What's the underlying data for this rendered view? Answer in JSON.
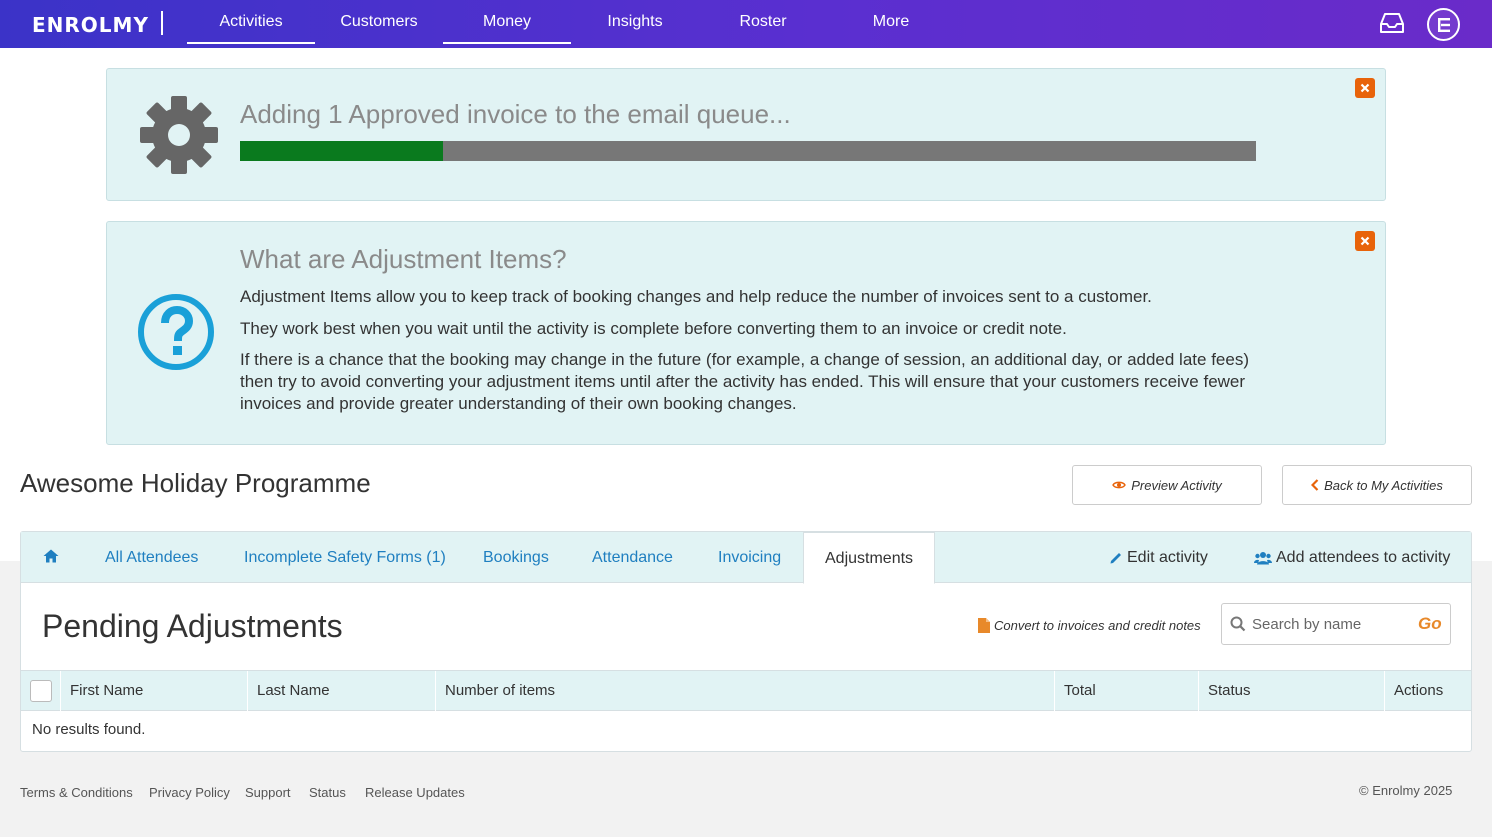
{
  "nav": {
    "logo": "ENROLMY",
    "items": [
      {
        "label": "Activities",
        "active": true
      },
      {
        "label": "Customers",
        "active": false
      },
      {
        "label": "Money",
        "active": true
      },
      {
        "label": "Insights",
        "active": false
      },
      {
        "label": "Roster",
        "active": false
      },
      {
        "label": "More",
        "active": false
      }
    ],
    "icons": [
      "inbox-icon",
      "user-avatar"
    ]
  },
  "progress_alert": {
    "title": "Adding 1 Approved invoice to the email queue...",
    "progress_fraction": 0.2,
    "icon": "gear-icon"
  },
  "info_alert": {
    "title": "What are Adjustment Items?",
    "icon": "question-circle-icon",
    "paragraphs": [
      "Adjustment Items allow you to keep track of booking changes and help reduce the number of invoices sent to a customer.",
      "They work best when you wait until the activity is complete before converting them to an invoice or credit note.",
      "If there is a chance that the booking may change in the future (for example, a change of session, an additional day, or added late fees) then try to avoid converting your adjustment items until after the activity has ended. This will ensure that your customers receive fewer invoices and provide greater understanding of their own booking changes."
    ]
  },
  "activity": {
    "title": "Awesome Holiday Programme",
    "preview_label": "Preview Activity",
    "back_label": "Back to My Activities"
  },
  "tabs": {
    "items": [
      "All Attendees",
      "Incomplete Safety Forms (1)",
      "Bookings",
      "Attendance",
      "Invoicing",
      "Adjustments"
    ],
    "active": "Adjustments",
    "edit_label": "Edit activity",
    "add_label": "Add attendees to activity"
  },
  "pending": {
    "title": "Pending Adjustments",
    "convert_label": "Convert to invoices and credit notes",
    "search_placeholder": "Search by name",
    "search_go": "Go",
    "columns": [
      "First Name",
      "Last Name",
      "Number of items",
      "Total",
      "Status",
      "Actions"
    ],
    "empty_message": "No results found."
  },
  "footer": {
    "links": [
      "Terms & Conditions",
      "Privacy Policy",
      "Support",
      "Status",
      "Release Updates"
    ],
    "copyright": "© Enrolmy 2025"
  },
  "colors": {
    "nav_gradient_start": "#3b33c8",
    "nav_gradient_end": "#6a2bc9",
    "alert_bg": "#e1f3f4",
    "progress_fill": "#0a7a1e",
    "progress_track": "#777777",
    "link_blue": "#1f7fc0",
    "accent_orange": "#e8630a",
    "question_icon": "#1aa0d8"
  }
}
